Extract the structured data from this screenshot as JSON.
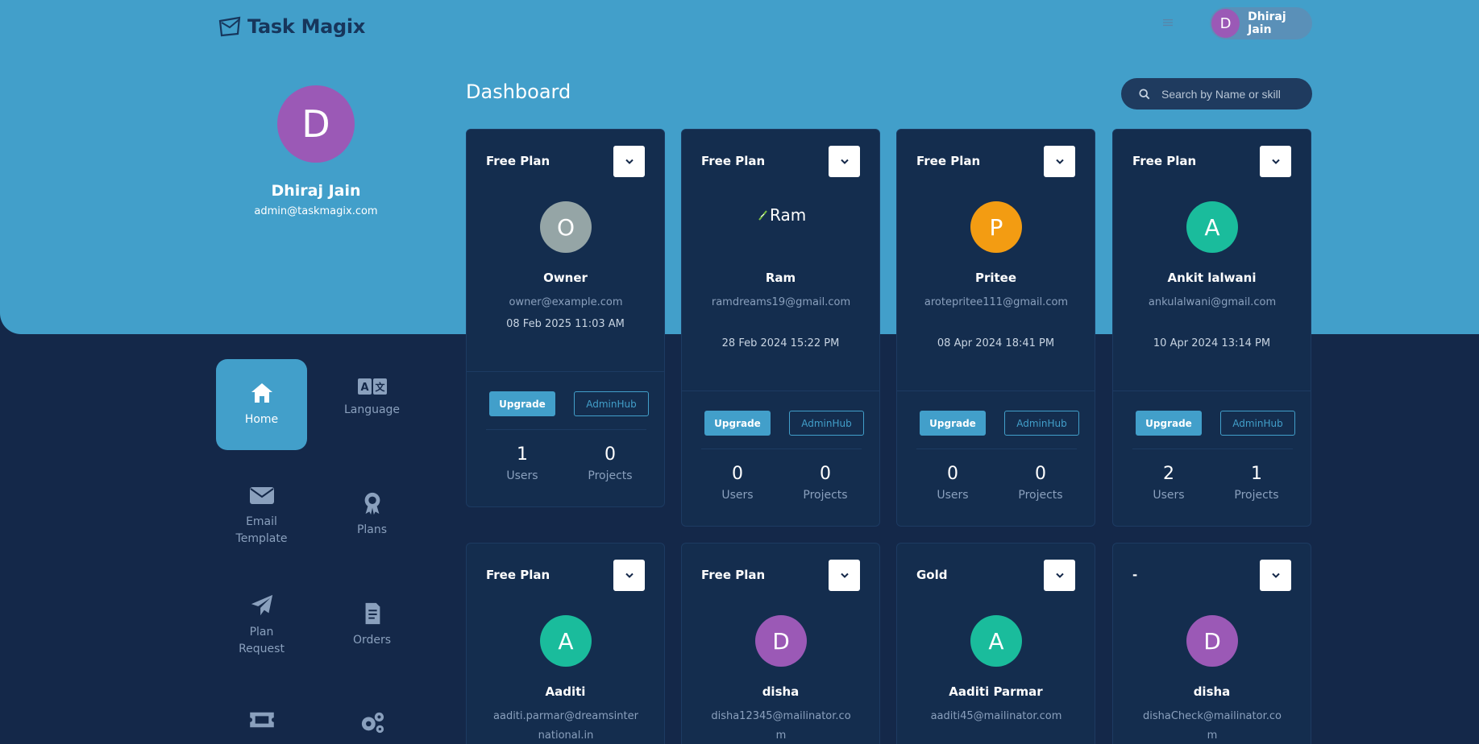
{
  "app": {
    "name": "Task Magix"
  },
  "header": {
    "user_initial": "D",
    "user_name": "Dhiraj Jain"
  },
  "profile": {
    "initial": "D",
    "name": "Dhiraj Jain",
    "email": "admin@taskmagix.com"
  },
  "nav": [
    {
      "label": "Home",
      "icon": "home-icon",
      "active": true
    },
    {
      "label": "Language",
      "icon": "language-icon",
      "active": false
    },
    {
      "label": "Email Template",
      "icon": "envelope-icon",
      "active": false
    },
    {
      "label": "Plans",
      "icon": "award-icon",
      "active": false
    },
    {
      "label": "Plan Request",
      "icon": "paper-plane-icon",
      "active": false
    },
    {
      "label": "Orders",
      "icon": "receipt-icon",
      "active": false
    },
    {
      "label": "",
      "icon": "ticket-icon",
      "active": false
    },
    {
      "label": "",
      "icon": "gears-icon",
      "active": false
    }
  ],
  "main": {
    "title": "Dashboard",
    "search_placeholder": "Search by Name or skill",
    "upgrade_label": "Upgrade",
    "adminhub_label": "AdminHub",
    "users_label": "Users",
    "projects_label": "Projects"
  },
  "cards": [
    {
      "plan": "Free Plan",
      "initial": "O",
      "avatar_color": "#95a5a6",
      "name": "Owner",
      "email": "owner@example.com",
      "date": "08 Feb 2025 11:03 AM",
      "users": "1",
      "projects": "0",
      "image": false
    },
    {
      "plan": "Free Plan",
      "initial": "Ram",
      "avatar_color": "",
      "name": "Ram",
      "email": "ramdreams19@gmail.com",
      "date": "28 Feb 2024 15:22 PM",
      "users": "0",
      "projects": "0",
      "image": true
    },
    {
      "plan": "Free Plan",
      "initial": "P",
      "avatar_color": "#f39c12",
      "name": "Pritee",
      "email": "arotepritee111@gmail.com",
      "date": "08 Apr 2024 18:41 PM",
      "users": "0",
      "projects": "0",
      "image": false
    },
    {
      "plan": "Free Plan",
      "initial": "A",
      "avatar_color": "#1abc9c",
      "name": "Ankit lalwani",
      "email": "ankulalwani@gmail.com",
      "date": "10 Apr 2024 13:14 PM",
      "users": "2",
      "projects": "1",
      "image": false
    },
    {
      "plan": "Free Plan",
      "initial": "A",
      "avatar_color": "#1abc9c",
      "name": "Aaditi",
      "email": "aaditi.parmar@dreamsinternational.in",
      "image": false
    },
    {
      "plan": "Free Plan",
      "initial": "D",
      "avatar_color": "#9b59b6",
      "name": "disha",
      "email": "disha12345@mailinator.com",
      "image": false
    },
    {
      "plan": "Gold",
      "initial": "A",
      "avatar_color": "#1abc9c",
      "name": "Aaditi Parmar",
      "email": "aaditi45@mailinator.com",
      "image": false
    },
    {
      "plan": "-",
      "initial": "D",
      "avatar_color": "#9b59b6",
      "name": "disha",
      "email": "dishaCheck@mailinator.com",
      "image": false
    }
  ],
  "colors": {
    "hero": "#429fca",
    "background": "#142849",
    "card": "#142d4e",
    "accent": "#429fca"
  }
}
